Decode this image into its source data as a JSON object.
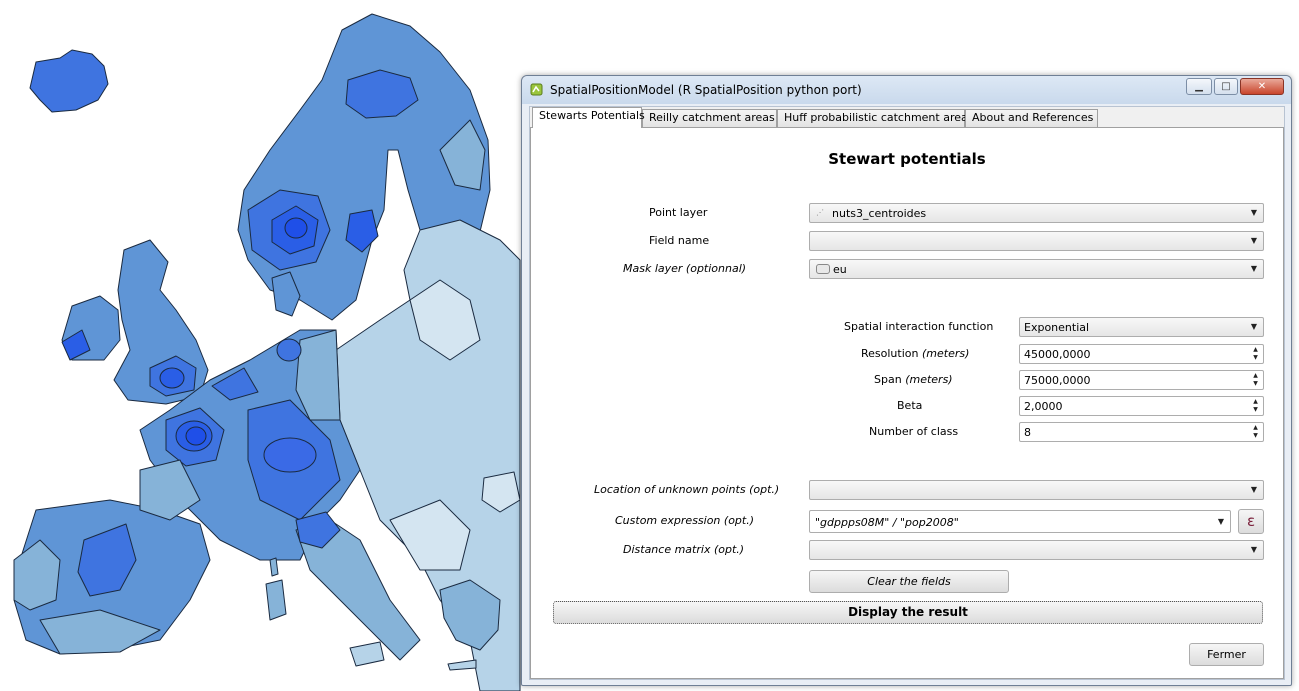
{
  "window": {
    "title": "SpatialPositionModel (R SpatialPosition python port)",
    "buttons": {
      "minimize": "▁",
      "maximize": "□",
      "close": "✕"
    }
  },
  "tabs": [
    {
      "label": "Stewarts Potentials",
      "active": true
    },
    {
      "label": "Reilly catchment areas",
      "active": false
    },
    {
      "label": "Huff probabilistic catchment areas",
      "active": false
    },
    {
      "label": "About and References",
      "active": false
    }
  ],
  "panel": {
    "heading": "Stewart potentials",
    "point_layer": {
      "label": "Point layer",
      "value": "nuts3_centroides"
    },
    "field_name": {
      "label": "Field name",
      "value": ""
    },
    "mask_layer": {
      "label": "Mask layer (optionnal)",
      "value": "eu"
    },
    "spatial_function": {
      "label": "Spatial interaction function",
      "value": "Exponential"
    },
    "resolution": {
      "label_prefix": "Resolution ",
      "label_unit": "(meters)",
      "value": "45000,0000"
    },
    "span": {
      "label_prefix": "Span ",
      "label_unit": "(meters)",
      "value": "75000,0000"
    },
    "beta": {
      "label": "Beta",
      "value": "2,0000"
    },
    "nb_class": {
      "label": "Number of class",
      "value": "8"
    },
    "unknown_points": {
      "label": "Location of unknown points (opt.)",
      "value": ""
    },
    "custom_expression": {
      "label": "Custom expression (opt.)",
      "value": "\"gdppps08M\" / \"pop2008\"",
      "epsilon": "ε"
    },
    "distance_matrix": {
      "label": "Distance matrix (opt.)",
      "value": ""
    },
    "clear_button": "Clear the fields",
    "display_button": "Display the result",
    "close_button": "Fermer"
  },
  "icons": {
    "combo_arrow": "▼",
    "spin_up": "▲",
    "spin_down": "▼"
  },
  "colors": {
    "darkest_blue": "#1f4fe8",
    "dark_blue": "#3f74e0",
    "mid_blue": "#5f95d6",
    "light_blue": "#86b3d8",
    "pale_blue": "#b6d3e8",
    "palest_blue": "#d4e5f1"
  }
}
